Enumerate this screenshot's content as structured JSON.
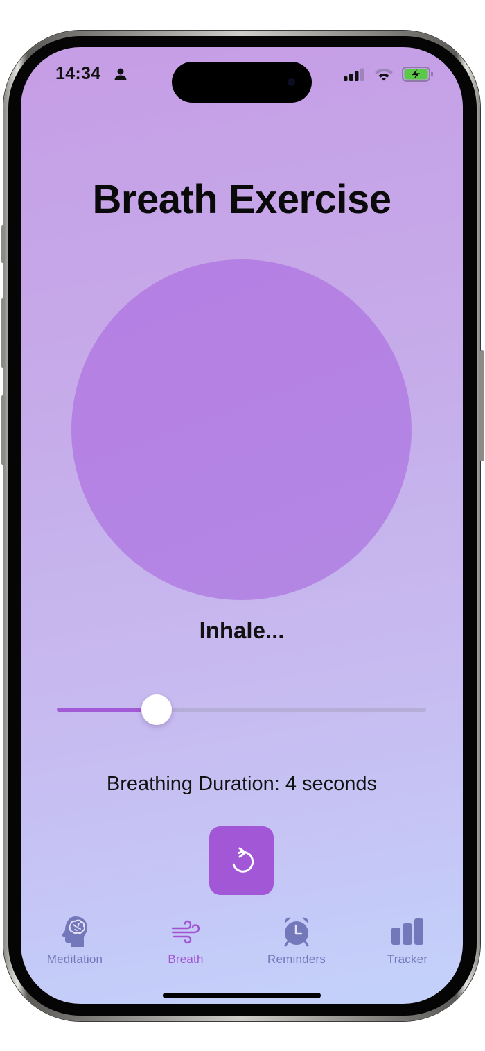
{
  "status_bar": {
    "time": "14:34",
    "person_icon": "person-fill-icon",
    "signal_icon": "cellular-signal-icon",
    "signal_bars_active": 3,
    "signal_bars_total": 4,
    "wifi_icon": "wifi-icon",
    "battery_icon": "battery-charging-icon",
    "battery_color": "#5cc84a"
  },
  "header": {
    "title": "Breath Exercise"
  },
  "breath_circle": {
    "color": "#b47fe3"
  },
  "phase_label": "Inhale...",
  "duration_slider": {
    "value_seconds": 4,
    "fill_fraction": 0.27,
    "accent_color": "#a25ad6"
  },
  "duration_label": "Breathing Duration: 4 seconds",
  "reset_button": {
    "icon": "arrow-clockwise-icon",
    "color": "#a257d6"
  },
  "tab_bar": {
    "active_color": "#a153d3",
    "inactive_color": "#7278b9",
    "tabs": [
      {
        "label": "Meditation",
        "icon": "brain-head-icon",
        "active": false
      },
      {
        "label": "Breath",
        "icon": "wind-icon",
        "active": true
      },
      {
        "label": "Reminders",
        "icon": "alarm-clock-icon",
        "active": false
      },
      {
        "label": "Tracker",
        "icon": "bar-chart-icon",
        "active": false
      }
    ]
  }
}
